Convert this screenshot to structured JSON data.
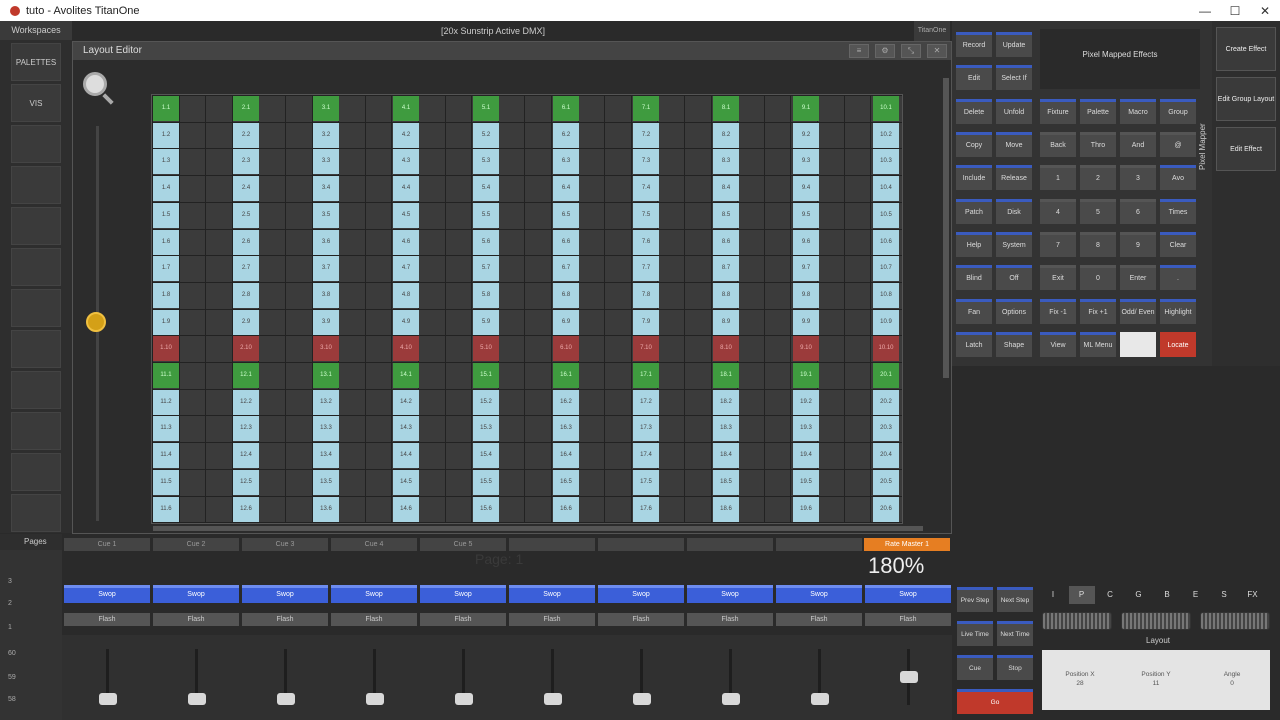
{
  "window": {
    "title": "tuto - Avolites TitanOne",
    "controls": [
      "—",
      "☐",
      "✕"
    ]
  },
  "sidebar": {
    "header": "Workspaces",
    "items": [
      "PALETTES",
      "VIS",
      "",
      "",
      "",
      "",
      "",
      "",
      "",
      "",
      "",
      ""
    ]
  },
  "dmx_header": "[20x Sunstrip Active DMX]",
  "titan_tag": "TitanOne",
  "editor": {
    "title": "Layout Editor"
  },
  "grid": {
    "columns": 10,
    "rows_shown": 16,
    "cells": [
      [
        "1.1",
        "1.2",
        "1.3",
        "1.4",
        "1.5",
        "1.6",
        "1.7",
        "1.8",
        "1.9",
        "1.10",
        "11.1",
        "11.2",
        "11.3",
        "11.4",
        "11.5",
        "11.6"
      ],
      [
        "2.1",
        "2.2",
        "2.3",
        "2.4",
        "2.5",
        "2.6",
        "2.7",
        "2.8",
        "2.9",
        "2.10",
        "12.1",
        "12.2",
        "12.3",
        "12.4",
        "12.5",
        "12.6"
      ],
      [
        "3.1",
        "3.2",
        "3.3",
        "3.4",
        "3.5",
        "3.6",
        "3.7",
        "3.8",
        "3.9",
        "3.10",
        "13.1",
        "13.2",
        "13.3",
        "13.4",
        "13.5",
        "13.6"
      ],
      [
        "4.1",
        "4.2",
        "4.3",
        "4.4",
        "4.5",
        "4.6",
        "4.7",
        "4.8",
        "4.9",
        "4.10",
        "14.1",
        "14.2",
        "14.3",
        "14.4",
        "14.5",
        "14.6"
      ],
      [
        "5.1",
        "5.2",
        "5.3",
        "5.4",
        "5.5",
        "5.6",
        "5.7",
        "5.8",
        "5.9",
        "5.10",
        "15.1",
        "15.2",
        "15.3",
        "15.4",
        "15.5",
        "15.6"
      ],
      [
        "6.1",
        "6.2",
        "6.3",
        "6.4",
        "6.5",
        "6.6",
        "6.7",
        "6.8",
        "6.9",
        "6.10",
        "16.1",
        "16.2",
        "16.3",
        "16.4",
        "16.5",
        "16.6"
      ],
      [
        "7.1",
        "7.2",
        "7.3",
        "7.4",
        "7.5",
        "7.6",
        "7.7",
        "7.8",
        "7.9",
        "7.10",
        "17.1",
        "17.2",
        "17.3",
        "17.4",
        "17.5",
        "17.6"
      ],
      [
        "8.1",
        "8.2",
        "8.3",
        "8.4",
        "8.5",
        "8.6",
        "8.7",
        "8.8",
        "8.9",
        "8.10",
        "18.1",
        "18.2",
        "18.3",
        "18.4",
        "18.5",
        "18.6"
      ],
      [
        "9.1",
        "9.2",
        "9.3",
        "9.4",
        "9.5",
        "9.6",
        "9.7",
        "9.8",
        "9.9",
        "9.10",
        "19.1",
        "19.2",
        "19.3",
        "19.4",
        "19.5",
        "19.6"
      ],
      [
        "10.1",
        "10.2",
        "10.3",
        "10.4",
        "10.5",
        "10.6",
        "10.7",
        "10.8",
        "10.9",
        "10.10",
        "20.1",
        "20.2",
        "20.3",
        "20.4",
        "20.5",
        "20.6"
      ]
    ],
    "colors": {
      "light": "#a9d5e3",
      "green": "#3f9b3f",
      "red": "#9b3b3b"
    }
  },
  "command_pad": {
    "left_col": [
      "Record",
      "Edit",
      "Delete",
      "Copy",
      "Include",
      "Patch",
      "Help",
      "Blind",
      "Fan",
      "Latch"
    ],
    "mid_col": [
      "Update",
      "Select If",
      "Unfold",
      "Move",
      "Release",
      "Disk",
      "System",
      "Off",
      "Options",
      "Shape"
    ],
    "row_top": [
      "Fixture",
      "Palette",
      "Macro",
      "Group"
    ],
    "row_2": [
      "Back",
      "Thro",
      "And",
      "@"
    ],
    "numpad": [
      [
        "1",
        "2",
        "3",
        "Avo"
      ],
      [
        "4",
        "5",
        "6",
        "Times"
      ],
      [
        "7",
        "8",
        "9",
        "Clear"
      ],
      [
        "Exit",
        "0",
        "Enter",
        "."
      ]
    ],
    "row_fix": [
      "Fix -1",
      "Fix +1",
      "Odd/ Even",
      "Highlight"
    ],
    "row_view": [
      "View",
      "ML Menu",
      "",
      "Locate"
    ]
  },
  "pixel_mapped_effects": "Pixel Mapped Effects",
  "pixel_mapper_label": "Pixel Mapper",
  "right_panel": [
    "Create Effect",
    "Edit Group Layout",
    "Edit Effect"
  ],
  "pages": {
    "label": "Pages",
    "numbers": [
      "3",
      "2",
      "1",
      "60",
      "59",
      "58"
    ]
  },
  "cue_tabs": [
    "Cue 1",
    "Cue 2",
    "Cue 3",
    "Cue 4",
    "Cue 5",
    "",
    "",
    "",
    ""
  ],
  "rate_master": "Rate Master 1",
  "page_ghost": "Page: 1",
  "percent": "180%",
  "faders": {
    "swop_label": "Swop",
    "flash_label": "Flash",
    "count": 10
  },
  "playback_buttons": {
    "prev_step": "Prev Step",
    "next_step": "Next Step",
    "live_time": "Live Time",
    "next_time": "Next Time",
    "cue": "Cue",
    "stop": "Stop",
    "go": "Go"
  },
  "attribute_tabs": [
    "I",
    "P",
    "C",
    "G",
    "B",
    "E",
    "S",
    "FX"
  ],
  "active_tab": "P",
  "layout_label": "Layout",
  "position": [
    {
      "label": "Position X",
      "value": "28"
    },
    {
      "label": "Position Y",
      "value": "11"
    },
    {
      "label": "Angle",
      "value": "0"
    }
  ]
}
